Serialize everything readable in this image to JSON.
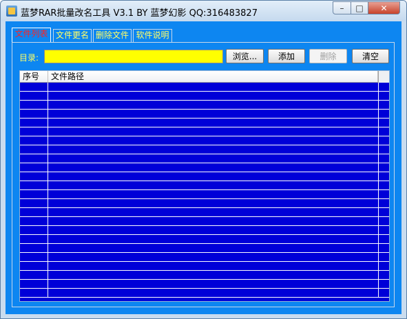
{
  "window": {
    "title": "蓝梦RAR批量改名工具 V3.1 BY 蓝梦幻影 QQ:316483827",
    "controls": {
      "minimize": "–",
      "maximize": "□",
      "close": "✕"
    }
  },
  "tabs": [
    {
      "label": "文件列表",
      "active": true
    },
    {
      "label": "文件更名",
      "active": false
    },
    {
      "label": "删除文件",
      "active": false
    },
    {
      "label": "软件说明",
      "active": false
    }
  ],
  "directory": {
    "label": "目录:",
    "value": ""
  },
  "buttons": {
    "browse": "浏览...",
    "add": "添加",
    "delete": "删除",
    "clear": "清空"
  },
  "list": {
    "columns": [
      "序号",
      "文件路径"
    ],
    "rows": []
  },
  "colors": {
    "accent": "#0d86f1",
    "list_bg": "#0000d8",
    "input_bg": "#ffff00",
    "tab_text": "#ffff66",
    "active_tab_text": "#ff2222"
  }
}
